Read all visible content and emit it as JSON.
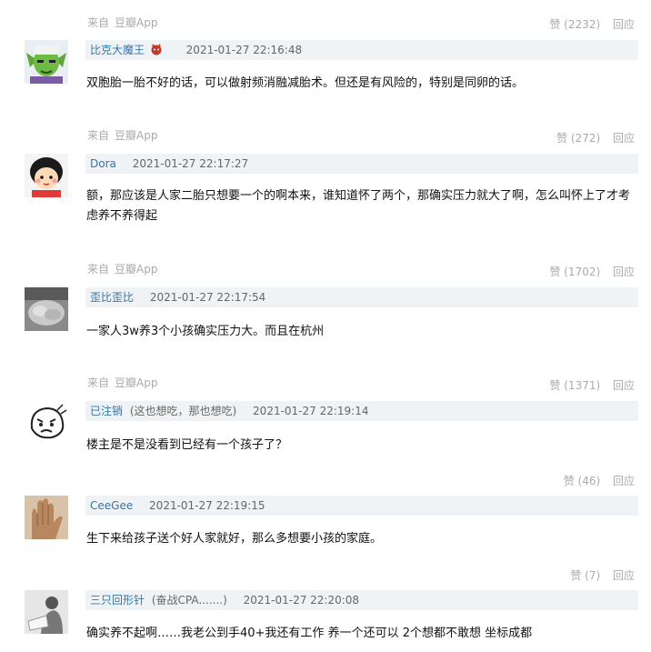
{
  "source_prefix": "来自",
  "source_app": "豆瓣App",
  "reply_label": "回应",
  "top": {
    "like_label": "赞 (2232)"
  },
  "comments": [
    {
      "user": "比克大魔王",
      "signature": "",
      "time": "2021-01-27 22:16:48",
      "text": "双胞胎一胎不好的话，可以做射频消融减胎术。但还是有风险的，特别是同卵的话。",
      "source_prefix": "来自",
      "source_app": "豆瓣App",
      "like_label": "赞 (272)",
      "reply_label": "回应",
      "avatar_icon": "piccolo-avatar-icon"
    },
    {
      "user": "Dora",
      "signature": "",
      "time": "2021-01-27 22:17:27",
      "text": "额，那应该是人家二胎只想要一个的啊本来，谁知道怀了两个，那确实压力就大了啊，怎么叫怀上了才考虑养不养得起",
      "source_prefix": "来自",
      "source_app": "豆瓣App",
      "like_label": "赞 (1702)",
      "reply_label": "回应",
      "avatar_icon": "cartoon-girl-avatar-icon"
    },
    {
      "user": "歪比歪比",
      "signature": "",
      "time": "2021-01-27 22:17:54",
      "text": "一家人3w养3个小孩确实压力大。而且在杭州",
      "source_prefix": "来自",
      "source_app": "豆瓣App",
      "like_label": "赞 (1371)",
      "reply_label": "回应",
      "avatar_icon": "sofa-avatar-icon"
    },
    {
      "user": "已注销",
      "signature": "(这也想吃，那也想吃)",
      "time": "2021-01-27 22:19:14",
      "text": "楼主是不是没看到已经有一个孩子了？",
      "source_prefix": "",
      "source_app": "",
      "like_label": "赞 (46)",
      "reply_label": "回应",
      "avatar_icon": "sketch-face-avatar-icon"
    },
    {
      "user": "CeeGee",
      "signature": "",
      "time": "2021-01-27 22:19:15",
      "text": "生下来给孩子送个好人家就好，那么多想要小孩的家庭。",
      "source_prefix": "",
      "source_app": "",
      "like_label": "赞 (7)",
      "reply_label": "回应",
      "avatar_icon": "hands-avatar-icon"
    },
    {
      "user": "三只回形针",
      "signature": "(奋战CPA.......)",
      "time": "2021-01-27 22:20:08",
      "text": "确实养不起啊……我老公到手40+我还有工作 养一个还可以 2个想都不敢想 坐标成都",
      "avatar_icon": "reading-person-avatar-icon"
    }
  ],
  "colors": {
    "link": "#3377aa",
    "meta_bg": "#f0f3f5",
    "muted": "#aaaaaa"
  }
}
